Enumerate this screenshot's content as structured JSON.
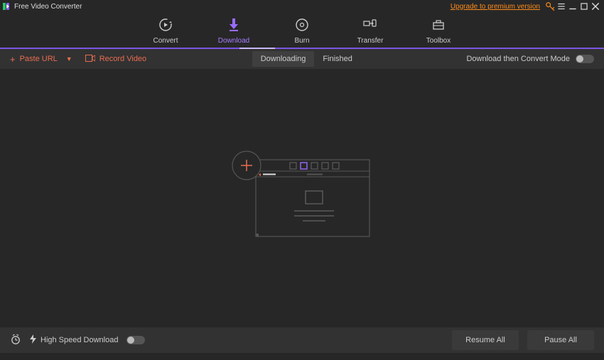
{
  "titlebar": {
    "app_title": "Free Video Converter",
    "upgrade_text": "Upgrade to premium version"
  },
  "tabs": {
    "convert": "Convert",
    "download": "Download",
    "burn": "Burn",
    "transfer": "Transfer",
    "toolbox": "Toolbox"
  },
  "subbar": {
    "paste_url": "Paste URL",
    "record_video": "Record Video",
    "downloading": "Downloading",
    "finished": "Finished",
    "download_mode": "Download then Convert Mode"
  },
  "footer": {
    "high_speed": "High Speed Download",
    "resume_all": "Resume All",
    "pause_all": "Pause All"
  },
  "colors": {
    "accent": "#a57bff",
    "orange": "#e86d50",
    "upgrade": "#ff8c1a"
  }
}
